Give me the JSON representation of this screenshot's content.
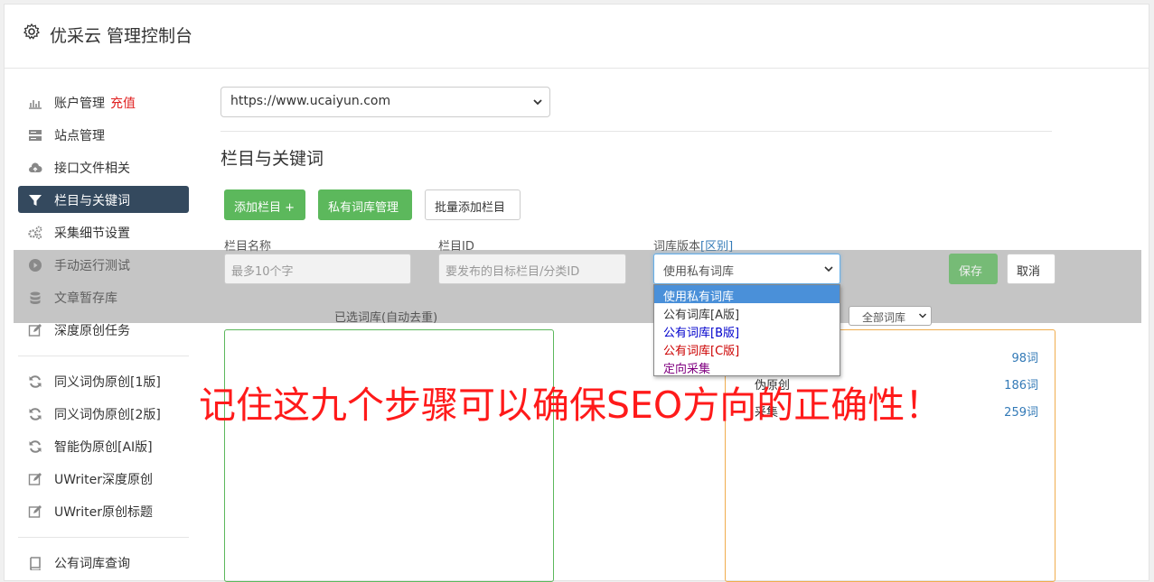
{
  "header": {
    "title": "优采云 管理控制台"
  },
  "sidebar": {
    "items": [
      {
        "label": "账户管理",
        "extra": "充值",
        "icon": "bar-chart-icon"
      },
      {
        "label": "站点管理",
        "icon": "server-icon"
      },
      {
        "label": "接口文件相关",
        "icon": "cloud-upload-icon"
      },
      {
        "label": "栏目与关键词",
        "icon": "filter-icon",
        "active": true
      },
      {
        "label": "采集细节设置",
        "icon": "gears-icon"
      },
      {
        "label": "手动运行测试",
        "icon": "play-circle-icon"
      },
      {
        "label": "文章暂存库",
        "icon": "database-icon"
      },
      {
        "label": "深度原创任务",
        "icon": "edit-icon"
      },
      {
        "label": "同义词伪原创[1版]",
        "icon": "refresh-icon"
      },
      {
        "label": "同义词伪原创[2版]",
        "icon": "refresh-icon"
      },
      {
        "label": "智能伪原创[AI版]",
        "icon": "refresh-icon"
      },
      {
        "label": "UWriter深度原创",
        "icon": "edit-icon"
      },
      {
        "label": "UWriter原创标题",
        "icon": "edit-icon"
      },
      {
        "label": "公有词库查询",
        "icon": "book-icon"
      }
    ]
  },
  "main": {
    "site_select": {
      "value": "https://www.ucaiyun.com"
    },
    "section_title": "栏目与关键词",
    "buttons": {
      "add_column": "添加栏目 +",
      "private_lib": "私有词库管理",
      "batch_add": "批量添加栏目"
    },
    "form": {
      "name_label": "栏目名称",
      "name_placeholder": "最多10个字",
      "id_label": "栏目ID",
      "id_placeholder": "要发布的目标栏目/分类ID",
      "version_label": "词库版本",
      "version_link": "[区别]",
      "version_value": "使用私有词库",
      "save": "保存",
      "cancel": "取消"
    },
    "version_options": [
      {
        "label": "使用私有词库",
        "color": "#ffffff",
        "selected": true
      },
      {
        "label": "公有词库[A版]",
        "color": "#333333"
      },
      {
        "label": "公有词库[B版]",
        "color": "#0000cc"
      },
      {
        "label": "公有词库[C版]",
        "color": "#cc0000"
      },
      {
        "label": "定向采集",
        "color": "#800080"
      }
    ],
    "selected_libs_label": "已选词库(自动去重)",
    "all_libs_select": "全部词库",
    "libraries": [
      {
        "name": "",
        "count": "98词"
      },
      {
        "name": "伪原创",
        "count": "186词"
      },
      {
        "name": "采集",
        "count": "259词"
      }
    ]
  },
  "overlay": {
    "text": "记住这九个步骤可以确保SEO方向的正确性！"
  }
}
